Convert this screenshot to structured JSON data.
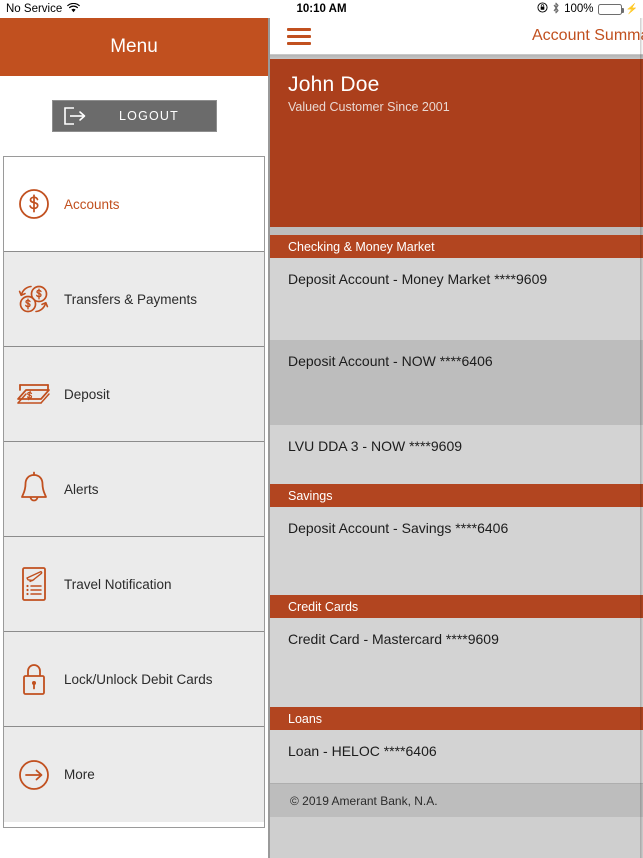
{
  "status_bar": {
    "carrier": "No Service",
    "wifi_icon": "wifi-icon",
    "time": "10:10 AM",
    "rotation_lock_icon": "rotation-lock-icon",
    "bluetooth_icon": "bluetooth-icon",
    "battery_percent": "100%",
    "charging_icon": "lightning-bolt-icon",
    "battery_color": "#4cd964"
  },
  "sidebar": {
    "header_title": "Menu",
    "logout": {
      "label": "LOGOUT",
      "icon": "logout-arrow-icon"
    },
    "items": [
      {
        "label": "Accounts",
        "icon": "dollar-circle-icon",
        "active": true
      },
      {
        "label": "Transfers & Payments",
        "icon": "transfer-coins-icon",
        "active": false
      },
      {
        "label": "Deposit",
        "icon": "cash-deposit-icon",
        "active": false
      },
      {
        "label": "Alerts",
        "icon": "bell-icon",
        "active": false
      },
      {
        "label": "Travel Notification",
        "icon": "travel-document-icon",
        "active": false
      },
      {
        "label": "Lock/Unlock Debit Cards",
        "icon": "padlock-icon",
        "active": false
      },
      {
        "label": "More",
        "icon": "arrow-circle-icon",
        "active": false
      }
    ]
  },
  "content": {
    "nav": {
      "menu_icon": "hamburger-menu-icon",
      "title": "Account Summary"
    },
    "profile": {
      "name": "John Doe",
      "subtitle": "Valued Customer Since 2001"
    },
    "sections": [
      {
        "title": "Checking & Money Market",
        "accounts": [
          {
            "label": "Deposit Account - Money Market ****9609",
            "shade": "a",
            "height": 82
          },
          {
            "label": "Deposit Account - NOW ****6406",
            "shade": "b",
            "height": 85
          },
          {
            "label": "LVU DDA 3 - NOW ****9609",
            "shade": "a",
            "height": 59
          }
        ]
      },
      {
        "title": "Savings",
        "accounts": [
          {
            "label": "Deposit Account - Savings ****6406",
            "shade": "a",
            "height": 88
          }
        ]
      },
      {
        "title": "Credit Cards",
        "accounts": [
          {
            "label": "Credit Card - Mastercard ****9609",
            "shade": "a",
            "height": 89
          }
        ]
      },
      {
        "title": "Loans",
        "accounts": [
          {
            "label": "Loan - HELOC ****6406",
            "shade": "a",
            "height": 53
          }
        ]
      }
    ],
    "footer": "© 2019 Amerant Bank, N.A."
  },
  "colors": {
    "brand_orange": "#c1501f",
    "header_orange": "#ab3f1c",
    "section_orange": "#b24520",
    "row_light": "#d3d3d3",
    "row_dark": "#bdbdbd",
    "logout_gray": "#6b6b6b"
  }
}
